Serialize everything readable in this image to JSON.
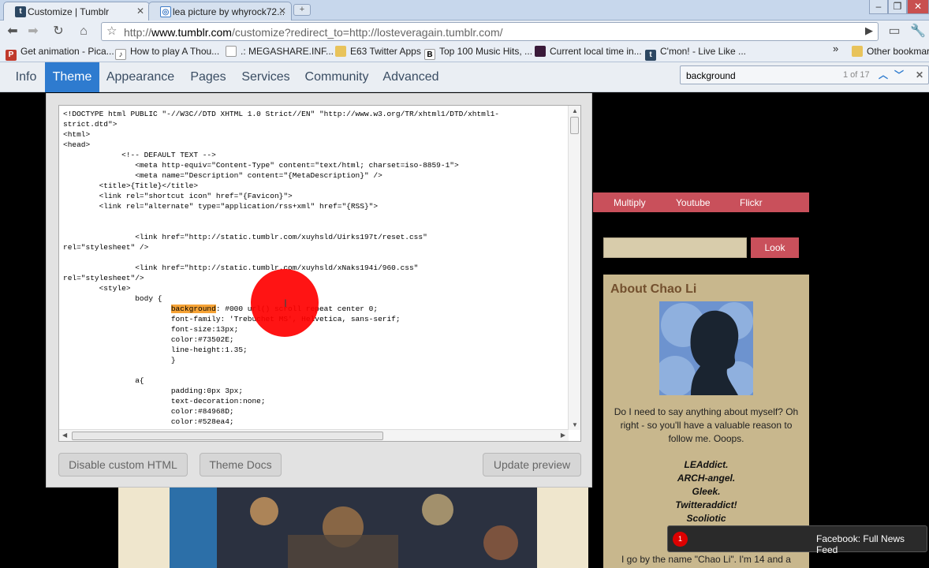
{
  "browser": {
    "tabs": [
      {
        "title": "Customize | Tumblr",
        "active": true,
        "favicon": "tumblr-icon"
      },
      {
        "title": "lea picture by whyrock72...",
        "active": false,
        "favicon": "photobucket-icon"
      }
    ],
    "url": {
      "scheme": "http://",
      "host": "www.tumblr.com",
      "path": "/customize?redirect_to=http://losteveragain.tumblr.com/"
    },
    "bookmarks": [
      {
        "label": "Get animation - Pica...",
        "icon": "picasa-icon"
      },
      {
        "label": "How to play A Thou...",
        "icon": "music-icon"
      },
      {
        "label": ".: MEGASHARE.INF...",
        "icon": "page-icon"
      },
      {
        "label": "E63 Twitter Apps",
        "icon": "folder-icon"
      },
      {
        "label": "Top 100 Music Hits, ...",
        "icon": "b-icon"
      },
      {
        "label": "Current local time in...",
        "icon": "clock-icon"
      },
      {
        "label": "C'mon! - Live Like ...",
        "icon": "tumblr-icon"
      }
    ],
    "other_bookmarks": "Other bookmarks",
    "overflow_glyph": "»",
    "find": {
      "query": "background",
      "count": "1 of 17"
    }
  },
  "tumblr_nav": {
    "items": [
      "Info",
      "Theme",
      "Appearance",
      "Pages",
      "Services",
      "Community",
      "Advanced"
    ],
    "active": "Theme"
  },
  "editor": {
    "lines": [
      "<!DOCTYPE html PUBLIC \"-//W3C//DTD XHTML 1.0 Strict//EN\" \"http://www.w3.org/TR/xhtml1/DTD/xhtml1-",
      "strict.dtd\">",
      "<html>",
      "<head>",
      "             <!-- DEFAULT TEXT -->",
      "                <meta http-equiv=\"Content-Type\" content=\"text/html; charset=iso-8859-1\">",
      "                <meta name=\"Description\" content=\"{MetaDescription}\" />",
      "        <title>{Title}</title>",
      "        <link rel=\"shortcut icon\" href=\"{Favicon}\">",
      "        <link rel=\"alternate\" type=\"application/rss+xml\" href=\"{RSS}\">",
      "",
      "",
      "                <link href=\"http://static.tumblr.com/xuyhsld/Uirks197t/reset.css\"",
      "rel=\"stylesheet\" />",
      "",
      "                <link href=\"http://static.tumblr.com/xuyhsld/xNaks194i/960.css\"",
      "rel=\"stylesheet\"/>",
      "        <style>",
      "                body {",
      "                        background: #000 url() scroll repeat center 0;",
      "                        font-family: 'Trebuchet MS', Helvetica, sans-serif;",
      "                        font-size:13px;",
      "                        color:#73502E;",
      "                        line-height:1.35;",
      "                        }",
      "",
      "                a{",
      "                        padding:0px 3px;",
      "                        text-decoration:none;",
      "                        color:#84968D;",
      "                        color:#528ea4;"
    ],
    "buttons": {
      "disable": "Disable custom HTML",
      "docs": "Theme Docs",
      "update": "Update preview"
    }
  },
  "blog": {
    "nav": [
      "Multiply",
      "Youtube",
      "Flickr"
    ],
    "search_button": "Look",
    "about_title": "About Chao Li",
    "about_text": "Do I need to say anything about myself? Oh right - so you'll have a valuable reason to follow me. Ooops.",
    "tags": [
      "LEAddict.",
      "ARCH-angel.",
      "Gleek.",
      "Twitteraddict!",
      "Scoliotic"
    ],
    "bio_start": "I go by the name \"Chao Li\". I'm 14 and a"
  },
  "notification": {
    "badge": "1",
    "text": "Facebook: Full News Feed"
  },
  "colors": {
    "tumblr_active": "#2e7bcf",
    "blog_accent": "#c9505b",
    "about_bg": "#c8b78d",
    "highlight": "#f6a336",
    "click_marker": "#ff0000"
  }
}
